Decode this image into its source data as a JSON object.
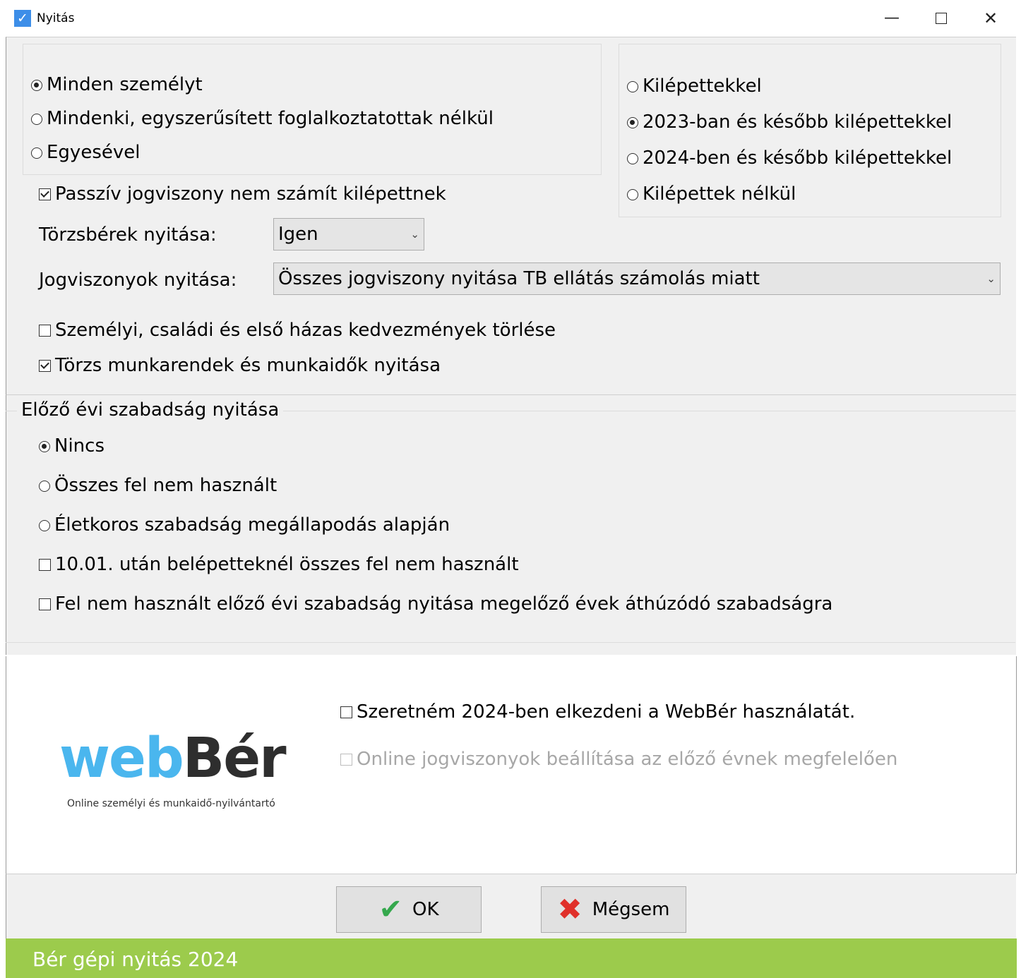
{
  "window": {
    "title": "Nyitás",
    "app_icon": "checkmark-icon",
    "minimize": "—",
    "maximize": "☐",
    "close": "✕"
  },
  "people_options": [
    {
      "label": "Minden személyt",
      "selected": true
    },
    {
      "label": "Mindenki, egyszerűsített foglalkoztatottak nélkül",
      "selected": false
    },
    {
      "label": "Egyesével",
      "selected": false
    }
  ],
  "leavers_options": [
    {
      "label": "Kilépettekkel",
      "selected": false
    },
    {
      "label": "2023-ban és később kilépettekkel",
      "selected": true
    },
    {
      "label": "2024-ben és később kilépettekkel",
      "selected": false
    },
    {
      "label": "Kilépettek nélkül",
      "selected": false
    }
  ],
  "passive_checkbox": {
    "label": "Passzív jogviszony nem számít kilépettnek",
    "checked": true
  },
  "base_wages": {
    "label": "Törzsbérek nyitása:",
    "value": "Igen"
  },
  "employments": {
    "label": "Jogviszonyok nyitása:",
    "value": "Összes jogviszony nyitása TB ellátás számolás miatt"
  },
  "discounts_checkbox": {
    "label": "Személyi, családi és első házas kedvezmények törlése",
    "checked": false
  },
  "schedules_checkbox": {
    "label": "Törzs munkarendek és munkaidők nyitása",
    "checked": true
  },
  "leave": {
    "title": "Előző évi szabadság nyitása",
    "options": [
      {
        "label": "Nincs",
        "selected": true
      },
      {
        "label": "Összes fel nem használt",
        "selected": false
      },
      {
        "label": "Életkoros szabadság megállapodás alapján",
        "selected": false
      }
    ],
    "after_oct_checkbox": {
      "label": "10.01. után belépetteknél összes fel nem használt",
      "checked": false
    },
    "carryover_checkbox": {
      "label": "Fel nem használt előző évi szabadság nyitása megelőző évek áthúzódó szabadságra",
      "checked": false
    }
  },
  "webber": {
    "logo_web": "web",
    "logo_ber": "Bér",
    "tagline": "Online személyi és munkaidő-nyilvántartó",
    "start_checkbox": {
      "label": "Szeretném 2024-ben elkezdeni a WebBér használatát.",
      "checked": false
    },
    "online_checkbox": {
      "label": "Online jogviszonyok beállítása az előző évnek megfelelően",
      "checked": false,
      "disabled": true
    }
  },
  "buttons": {
    "ok": "OK",
    "cancel": "Mégsem"
  },
  "footer": {
    "text": "Bér gépi nyitás 2024",
    "color": "#9ccb4c"
  }
}
